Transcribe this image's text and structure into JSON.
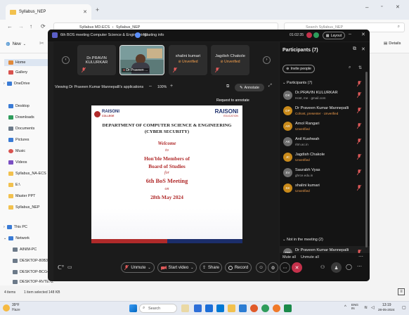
{
  "explorer": {
    "tab_title": "Syllabus_NEP",
    "breadcrumb": [
      "Syllabus MD-ECS",
      "Syllabus_NEP"
    ],
    "search_placeholder": "Search Syllabus_NEP",
    "new_label": "New",
    "details_label": "Details",
    "sidebar_items": [
      "Home",
      "Gallery",
      "OneDrive",
      "Desktop",
      "Downloads",
      "Documents",
      "Pictures",
      "Music",
      "Videos",
      "Syllabus_NA-ECS",
      "E:\\",
      "Master PPT",
      "Syllabus_NEP",
      "This PC",
      "Network",
      "AINIM-PC",
      "DESKTOP-80B3C",
      "DESKTOP-BCG4",
      "DESKTOP-RVTE7Z"
    ],
    "status_items": "4 items",
    "status_selected": "1 item selected 148 KB"
  },
  "meeting": {
    "window_title": "6th BOS meeting Computer Science & Engineering/...",
    "meeting_info": "Meeting info",
    "timer": "01:02:35",
    "layout_label": "Layout",
    "tiles": [
      {
        "name": "Dr.PRAVIN KULURKAR",
        "status": ""
      },
      {
        "name": "Dr Praveen ...",
        "status": ""
      },
      {
        "name": "shalini kumari",
        "status": "Unverified"
      },
      {
        "name": "Jagdish Chakole",
        "status": "Unverified"
      }
    ],
    "share_bar": {
      "viewing_text": "Viewing Dr Praveen Kumar Mannepalli's applications",
      "zoom": "100%",
      "annotate": "Annotate",
      "request_tooltip": "Request to annotate"
    },
    "slide": {
      "logo_left": "RAISONI",
      "logo_left_sub": "COLLEGE",
      "logo_right": "RAISONI",
      "logo_right_sub": "EDUCATION",
      "department": "DEPARTMENT OF COMPUTER SCIENCE & ENGINEERING",
      "subdept": "(CYBER SECURITY)",
      "welcome": "Welcome",
      "to": "to",
      "honble": "Hon'ble Members of",
      "board": "Board of Studies",
      "for": "for",
      "meeting_title": "6th BoS Meeting",
      "on": "on",
      "date": "28th May 2024"
    },
    "controls": {
      "unmute": "Unmute",
      "start_video": "Start video",
      "share": "Share",
      "record": "Record"
    },
    "participants": {
      "title": "Participants (7)",
      "invite": "Invite people",
      "section_in": "Participants (7)",
      "list": [
        {
          "initials": "DK",
          "name": "Dr.PRAVIN KULURKAR",
          "sub": "Host, me · gmail.com",
          "color": "#6d6d6d",
          "sub_color": "#aaaaaa"
        },
        {
          "initials": "DP",
          "name": "Dr Praveen Kumar Mannepalli",
          "sub": "Cohost, presenter · Unverified",
          "color": "#c98a1a",
          "sub_color": "#f6a04d"
        },
        {
          "initials": "AR",
          "name": "Amol Rangari",
          "sub": "Unverified",
          "color": "#c98a1a",
          "sub_color": "#f6a04d"
        },
        {
          "initials": "AK",
          "name": "Anil Kushwah",
          "sub": "ritm.ac.in",
          "color": "#6d6d6d",
          "sub_color": "#aaaaaa"
        },
        {
          "initials": "JC",
          "name": "Jagdish Chakole",
          "sub": "Unverified",
          "color": "#c98a1a",
          "sub_color": "#f6a04d"
        },
        {
          "initials": "SV",
          "name": "Saurabh Vyas",
          "sub": "ghrce.edu.in",
          "color": "#6d6d6d",
          "sub_color": "#aaaaaa"
        },
        {
          "initials": "SK",
          "name": "shalini kumari",
          "sub": "Unverified",
          "color": "#c98a1a",
          "sub_color": "#f6a04d"
        }
      ],
      "section_out": "Not in the meeting (2)",
      "out_list": [
        {
          "initials": "DM",
          "name": "Dr Praveen Kumar Mannepalli",
          "sub": "ghrietn.raisoni.net",
          "color": "#6d6d6d",
          "sub_color": "#aaaaaa"
        }
      ],
      "mute_all": "Mute all",
      "unmute_all": "Unmute all"
    }
  },
  "taskbar": {
    "weather_temp": "39°F",
    "weather_text": "Haze",
    "search_placeholder": "Search",
    "lang": "ENG IN",
    "time": "13:19",
    "date": "28-05-2024"
  },
  "colors": {
    "teams_dark": "#1f1f1f",
    "accent_orange": "#f6a04d",
    "end_call_red": "#c4314b",
    "slide_red": "#b02a2a",
    "slide_blue": "#1c2e6b"
  }
}
